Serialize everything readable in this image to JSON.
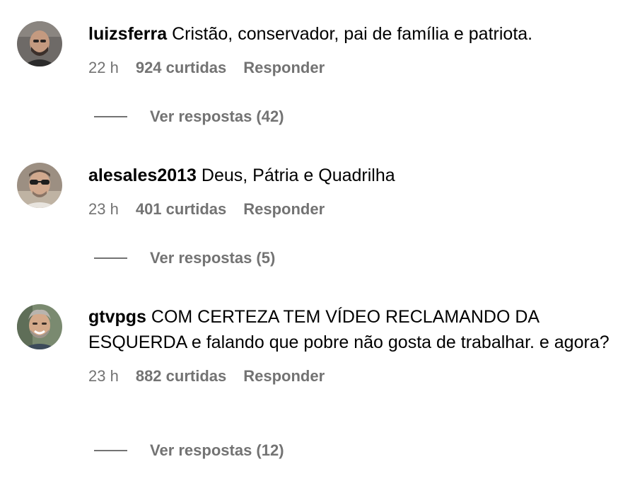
{
  "comments": [
    {
      "username": "luizsferra",
      "text": "Cristão, conservador, pai de família e patriota.",
      "time": "22 h",
      "likes": "924 curtidas",
      "reply_label": "Responder",
      "replies_label": "Ver respostas (42)"
    },
    {
      "username": "alesales2013",
      "text": "Deus, Pátria e Quadrilha",
      "time": "23 h",
      "likes": "401 curtidas",
      "reply_label": "Responder",
      "replies_label": "Ver respostas (5)"
    },
    {
      "username": "gtvpgs",
      "text": "COM CERTEZA TEM VÍDEO RECLAMANDO DA ESQUERDA e falando que pobre não gosta de trabalhar. e agora?",
      "time": "23 h",
      "likes": "882 curtidas",
      "reply_label": "Responder",
      "replies_label": "Ver respostas (12)"
    }
  ],
  "colors": {
    "text": "#000000",
    "muted": "#737373",
    "background": "#ffffff"
  }
}
